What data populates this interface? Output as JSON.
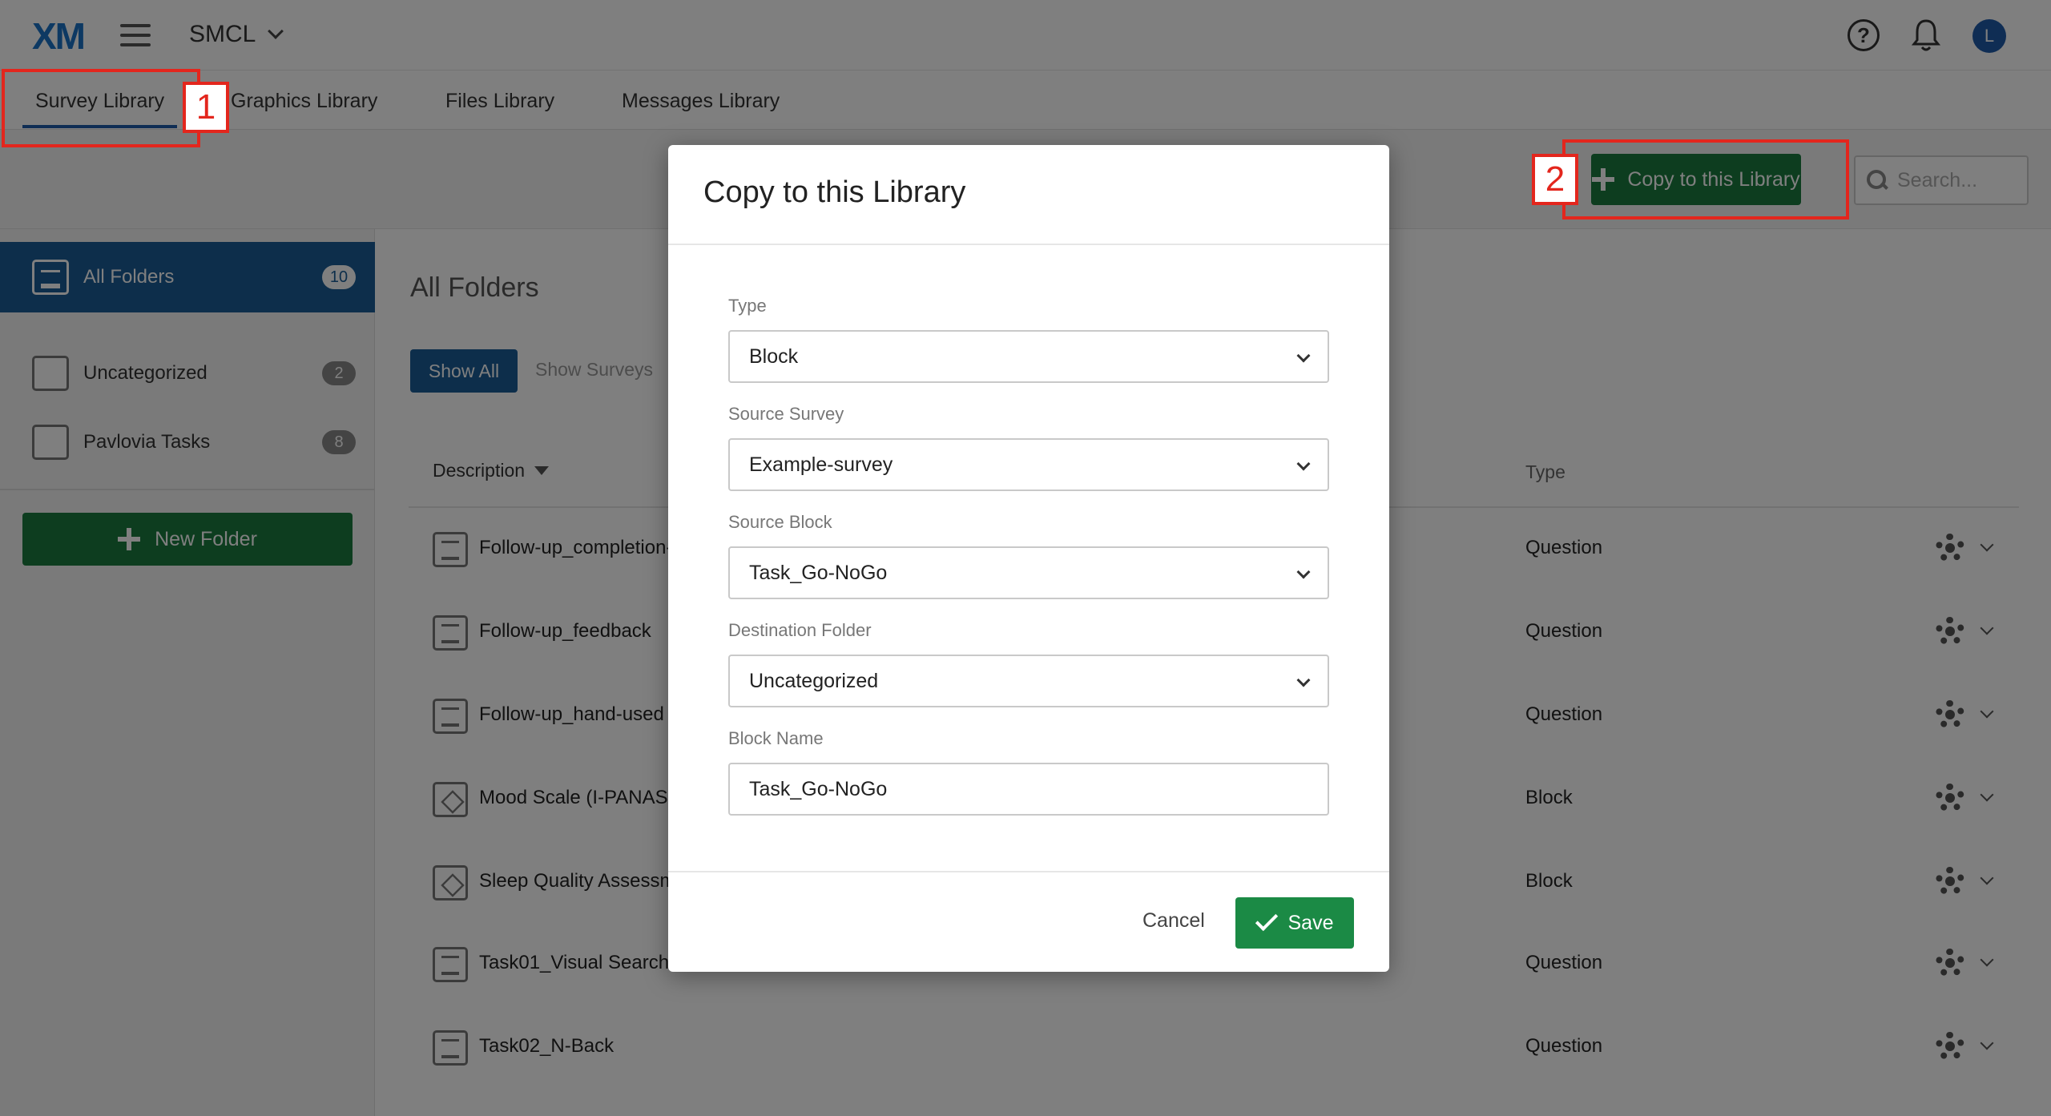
{
  "header": {
    "logo": "XM",
    "org_name": "SMCL",
    "avatar_initial": "L"
  },
  "tabs": [
    {
      "label": "Survey Library",
      "active": true
    },
    {
      "label": "Graphics Library"
    },
    {
      "label": "Files Library"
    },
    {
      "label": "Messages Library"
    }
  ],
  "toolbar": {
    "copy_label": "Copy to this Library",
    "search_placeholder": "Search..."
  },
  "sidebar": {
    "folders": [
      {
        "label": "All Folders",
        "count": "10",
        "active": true
      },
      {
        "label": "Uncategorized",
        "count": "2"
      },
      {
        "label": "Pavlovia Tasks",
        "count": "8"
      }
    ],
    "new_folder_label": "New Folder"
  },
  "main": {
    "title": "All Folders",
    "filters": {
      "show_all": "Show All",
      "show_surveys": "Show Surveys"
    },
    "columns": {
      "description": "Description",
      "type": "Type"
    },
    "rows": [
      {
        "name": "Follow-up_completion-",
        "type": "Question",
        "icon": "list-icon"
      },
      {
        "name": "Follow-up_feedback",
        "type": "Question",
        "icon": "list-icon"
      },
      {
        "name": "Follow-up_hand-used",
        "type": "Question",
        "icon": "list-icon"
      },
      {
        "name": "Mood Scale (I-PANAS-S",
        "type": "Block",
        "icon": "cube-icon"
      },
      {
        "name": "Sleep Quality Assessm",
        "type": "Block",
        "icon": "cube-icon"
      },
      {
        "name": "Task01_Visual Search",
        "type": "Question",
        "icon": "list-icon"
      },
      {
        "name": "Task02_N-Back",
        "type": "Question",
        "icon": "list-icon"
      }
    ]
  },
  "modal": {
    "title": "Copy to this Library",
    "fields": {
      "type": {
        "label": "Type",
        "value": "Block"
      },
      "source_survey": {
        "label": "Source Survey",
        "value": "Example-survey"
      },
      "source_block": {
        "label": "Source Block",
        "value": "Task_Go-NoGo"
      },
      "destination_folder": {
        "label": "Destination Folder",
        "value": "Uncategorized"
      },
      "block_name": {
        "label": "Block Name",
        "value": "Task_Go-NoGo"
      }
    },
    "cancel_label": "Cancel",
    "save_label": "Save"
  },
  "annotations": {
    "marker1": "1",
    "marker2": "2",
    "color": "#e3261d"
  },
  "colors": {
    "brand_blue": "#1a5d97",
    "action_green": "#1b7a3e"
  }
}
